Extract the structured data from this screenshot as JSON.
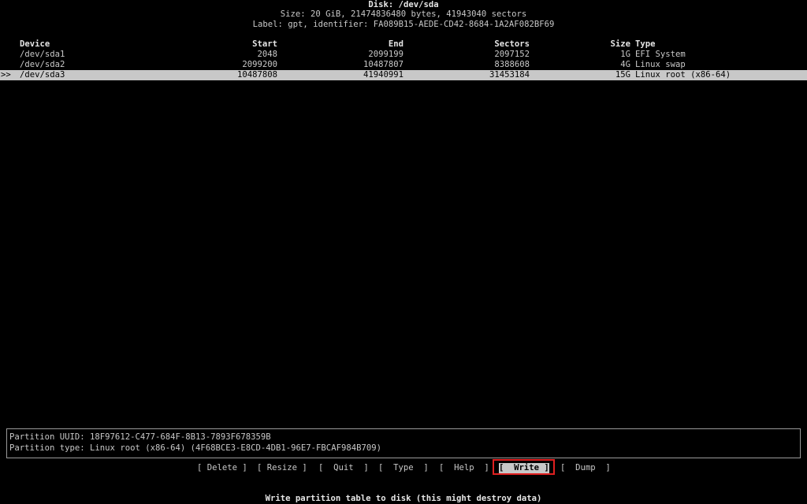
{
  "header": {
    "disk_title": "Disk: /dev/sda",
    "size_line": "Size: 20 GiB, 21474836480 bytes, 41943040 sectors",
    "label_line": "Label: gpt, identifier: FA089B15-AEDE-CD42-8684-1A2AF082BF69"
  },
  "table": {
    "columns": {
      "device": "Device",
      "start": "Start",
      "end": "End",
      "sectors": "Sectors",
      "size": "Size",
      "type": "Type"
    },
    "rows": [
      {
        "marker": "",
        "device": "/dev/sda1",
        "start": "2048",
        "end": "2099199",
        "sectors": "2097152",
        "size": "1G",
        "type": "EFI System"
      },
      {
        "marker": "",
        "device": "/dev/sda2",
        "start": "2099200",
        "end": "10487807",
        "sectors": "8388608",
        "size": "4G",
        "type": "Linux swap"
      },
      {
        "marker": ">>",
        "device": "/dev/sda3",
        "start": "10487808",
        "end": "41940991",
        "sectors": "31453184",
        "size": "15G",
        "type": "Linux root (x86-64)"
      }
    ],
    "selected_row": 2
  },
  "info": {
    "uuid_line": "Partition UUID: 18F97612-C477-684F-8B13-7893F678359B",
    "type_line": "Partition type: Linux root (x86-64) (4F68BCE3-E8CD-4DB1-96E7-FBCAF984B709)"
  },
  "menu": {
    "delete": "[ Delete ]",
    "resize": "[ Resize ]",
    "quit": "[  Quit  ]",
    "type": "[  Type  ]",
    "help": "[  Help  ]",
    "write": "[  Write ]",
    "dump": "[  Dump  ]",
    "selected": "write"
  },
  "status_line": "Write partition table to disk (this might destroy data)",
  "colors": {
    "background": "#000000",
    "text": "#c8c8c8",
    "highlight": "#c8c8c8",
    "focus_outline": "#e02020"
  }
}
